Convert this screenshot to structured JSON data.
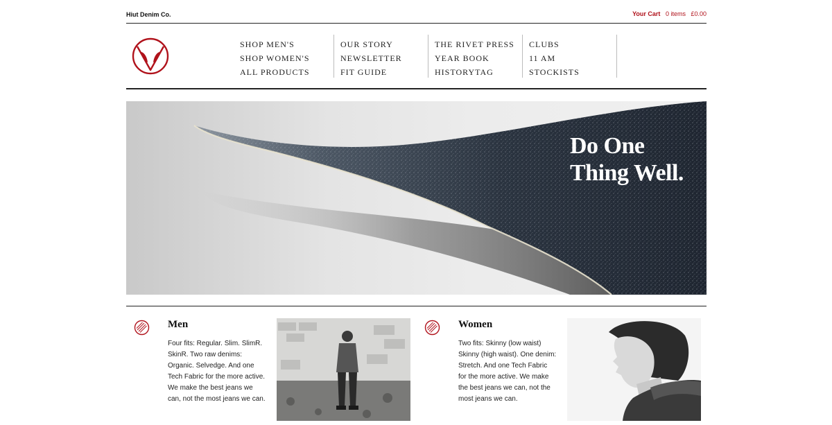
{
  "topbar": {
    "brand": "Hiut Denim Co.",
    "cart_label": "Your Cart",
    "cart_items": "0 items",
    "cart_total": "£0.00"
  },
  "nav": {
    "col1": [
      "SHOP MEN'S",
      "SHOP WOMEN'S",
      "ALL PRODUCTS"
    ],
    "col2": [
      "OUR STORY",
      "NEWSLETTER",
      "FIT GUIDE"
    ],
    "col3": [
      "THE RIVET PRESS",
      "YEAR BOOK",
      "HISTORYTAG"
    ],
    "col4": [
      "CLUBS",
      "11 AM",
      "STOCKISTS"
    ]
  },
  "hero": {
    "title": "Do One Thing Well."
  },
  "features": {
    "men": {
      "title": "Men",
      "text": "Four fits: Regular. Slim. SlimR. SkinR. Two raw denims: Organic. Selvedge. And one Tech Fabric for the more active. We make the best jeans we can, not the most jeans we can."
    },
    "women": {
      "title": "Women",
      "text": "Two fits: Skinny (low waist) Skinny (high waist). One denim: Stretch. And one Tech Fabric for the more active. We make the best jeans we can, not the most jeans we can."
    }
  },
  "colors": {
    "accent": "#b0121b",
    "denim": "#2b3440"
  },
  "icons": {
    "logo": "owl-logo-icon",
    "feature": "hatched-circle-icon"
  }
}
